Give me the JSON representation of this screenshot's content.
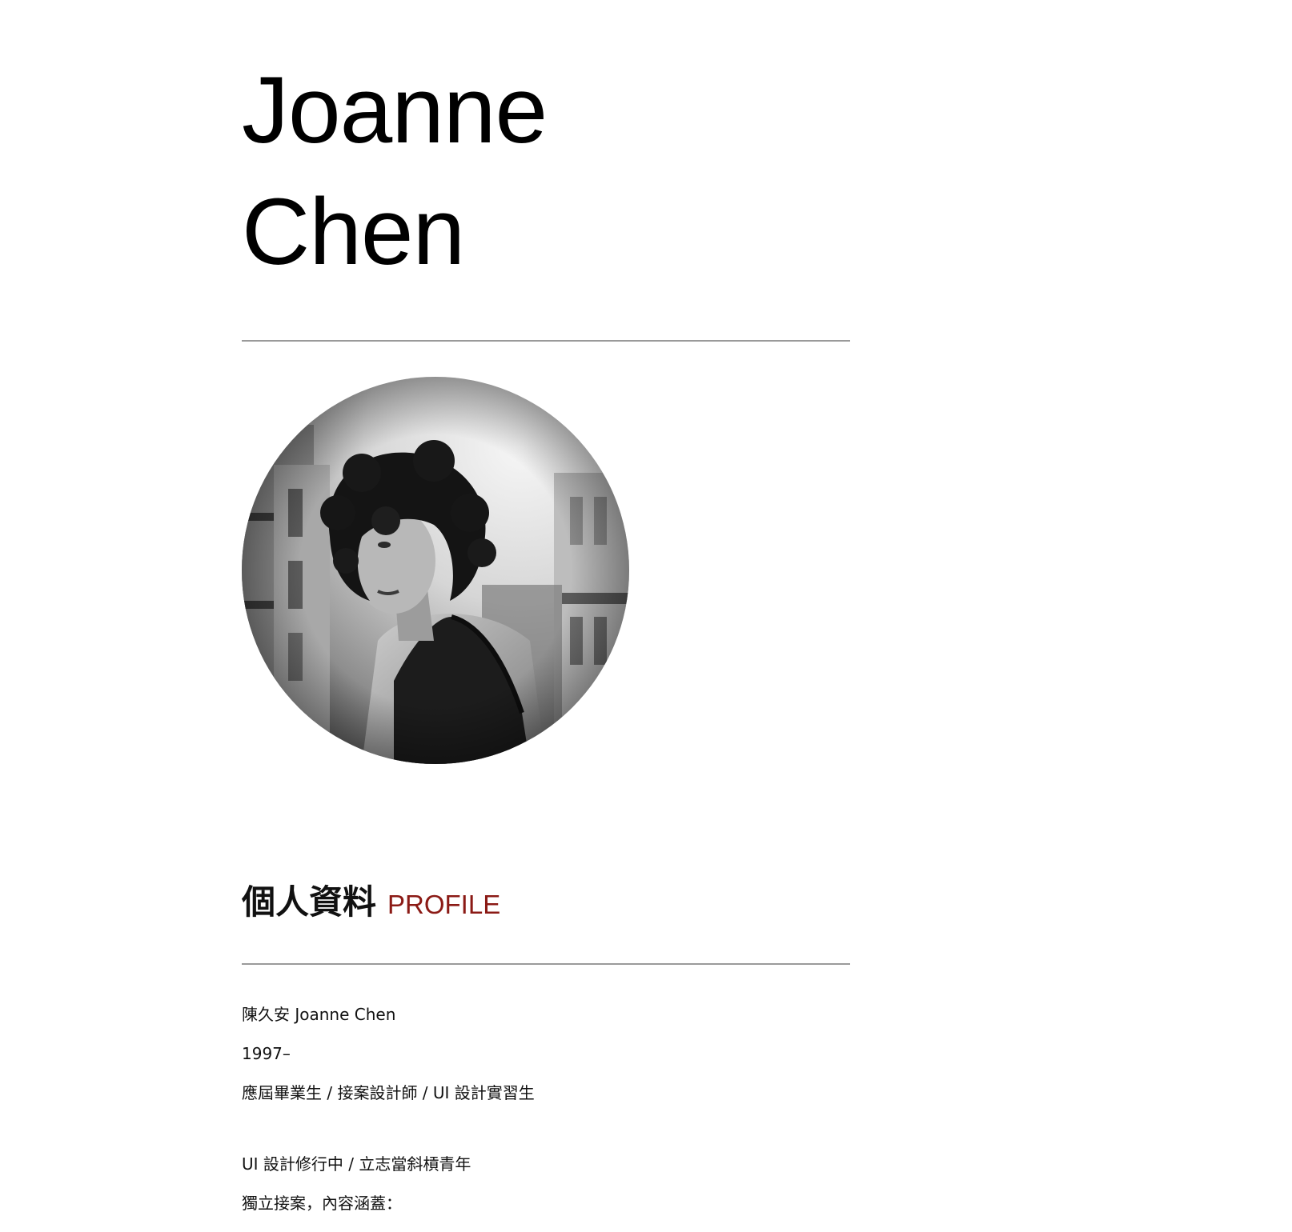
{
  "header": {
    "first_name": "Joanne",
    "last_name": "Chen"
  },
  "profile_photo": {
    "icon": "portrait-photo-icon"
  },
  "profile_section": {
    "title_zh": "個人資料",
    "title_en": "PROFILE",
    "title_en_color": "#8b1a15",
    "lines": [
      "陳久安 Joanne Chen",
      "1997–",
      "應屆畢業生 / 接案設計師 / UI 設計實習生",
      "UI 設計修行中 / 立志當斜槓青年",
      "獨立接案，內容涵蓋："
    ]
  }
}
